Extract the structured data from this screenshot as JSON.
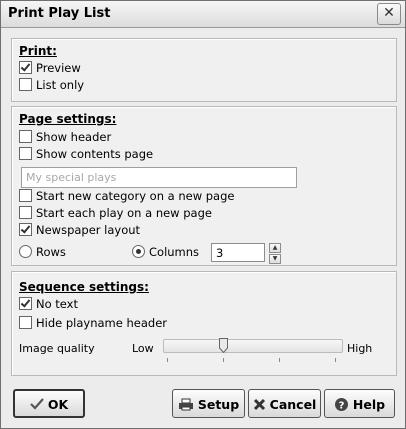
{
  "window": {
    "title": "Print Play List",
    "close_glyph": "✕"
  },
  "print_group": {
    "title": "Print:",
    "options": [
      {
        "label": "Preview",
        "checked": true
      },
      {
        "label": "List only",
        "checked": false
      }
    ]
  },
  "page_settings": {
    "title": "Page settings:",
    "show_header": {
      "label": "Show header",
      "checked": false
    },
    "show_contents": {
      "label": "Show contents page",
      "checked": false
    },
    "contents_title": {
      "value": "My special plays"
    },
    "new_category": {
      "label": "Start new category on a new page",
      "checked": false
    },
    "each_play": {
      "label": "Start each play on a new page",
      "checked": false
    },
    "newspaper": {
      "label": "Newspaper layout",
      "checked": true
    },
    "layout_rows": {
      "label": "Rows",
      "selected": false
    },
    "layout_columns": {
      "label": "Columns",
      "selected": true
    },
    "columns_value": "3"
  },
  "sequence_settings": {
    "title": "Sequence settings:",
    "no_text": {
      "label": "No text",
      "checked": true
    },
    "hide_playname": {
      "label": "Hide playname header",
      "checked": false
    },
    "image_quality": {
      "label": "Image quality",
      "low": "Low",
      "high": "High",
      "level": 0.33
    }
  },
  "buttons": {
    "ok": {
      "label": "OK",
      "icon": "checkmark-icon"
    },
    "setup": {
      "label": "Setup",
      "icon": "printer-icon"
    },
    "cancel": {
      "label": "Cancel",
      "icon": "cross-icon"
    },
    "help": {
      "label": "Help",
      "icon": "question-icon"
    }
  }
}
